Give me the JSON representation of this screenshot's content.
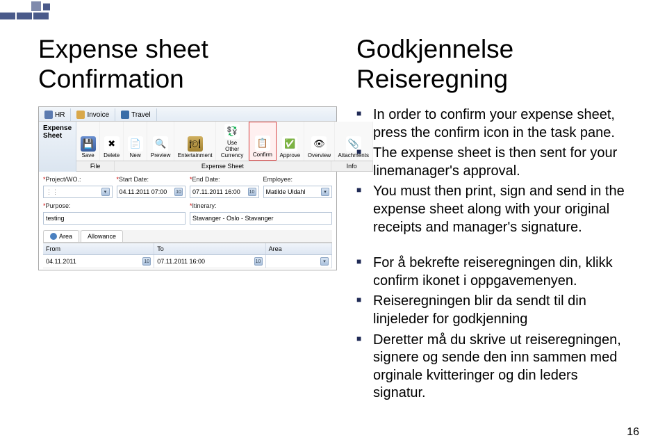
{
  "title_left": "Expense sheet Confirmation",
  "title_right": "Godkjennelse Reiseregning",
  "page_number": "16",
  "bullets_en": [
    "In order to confirm your expense sheet, press the confirm icon in the task pane.",
    "The expense sheet is then sent for your linemanager's approval.",
    "You must then print, sign and send in the expense sheet along with your original receipts and manager's signature."
  ],
  "bullets_no": [
    "For å bekrefte reiseregningen din, klikk confirm ikonet i oppgavemenyen.",
    "Reiseregningen blir da sendt til din linjeleder for godkjenning",
    "Deretter må du skrive ut reiseregningen, signere og sende den inn sammen med orginale kvitteringer og din leders signatur."
  ],
  "screenshot": {
    "tabs": {
      "hr": "HR",
      "invoice": "Invoice",
      "travel": "Travel"
    },
    "sidebar_title": "Expense Sheet",
    "toolbar": {
      "save": "Save",
      "delete": "Delete",
      "new": "New",
      "preview": "Preview",
      "entertainment": "Entertainment",
      "use_other_currency": "Use Other\nCurrency",
      "confirm": "Confirm",
      "approve": "Approve",
      "overview": "Overview",
      "attachments": "Attachments"
    },
    "groups": {
      "file": "File",
      "expense_sheet": "Expense Sheet",
      "info": "Info"
    },
    "form": {
      "project_label": "*Project/WO.:",
      "start_label": "*Start Date:",
      "start_value": "04.11.2011 07:00",
      "end_label": "*End Date:",
      "end_value": "07.11.2011 16:00",
      "employee_label": "Employee:",
      "employee_value": "Matilde Uldahl",
      "purpose_label": "*Purpose:",
      "purpose_value": "testing",
      "itinerary_label": "*Itinerary:",
      "itinerary_value": "Stavanger - Oslo - Stavanger"
    },
    "subtabs": {
      "area": "Area",
      "allowance": "Allowance"
    },
    "grid": {
      "head_from": "From",
      "head_to": "To",
      "head_area": "Area",
      "row_from": "04.11.2011",
      "row_to": "07.11.2011 16:00"
    },
    "dd_glyph": "10"
  }
}
